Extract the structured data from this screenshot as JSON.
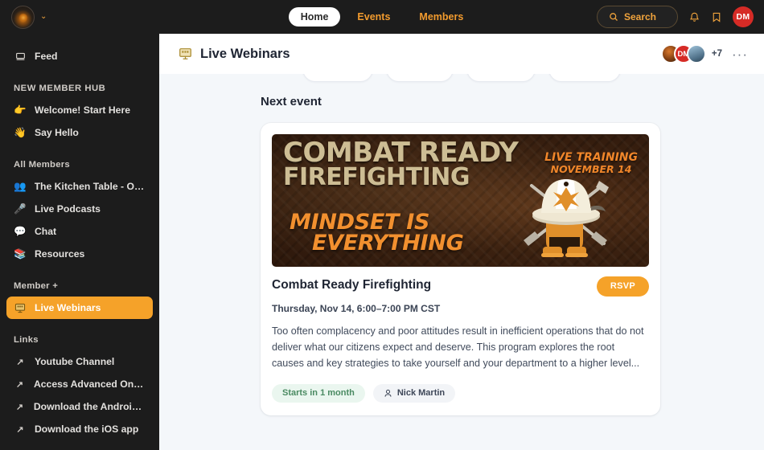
{
  "topbar": {
    "logo_name": "community-logo",
    "chevron": "⌄",
    "nav": [
      {
        "label": "Home",
        "active": true
      },
      {
        "label": "Events",
        "active": false
      },
      {
        "label": "Members",
        "active": false
      }
    ],
    "search_label": "Search",
    "notifications_icon": "bell-icon",
    "bookmarks_icon": "bookmark-icon",
    "user_initials": "DM"
  },
  "sidebar": {
    "feed": {
      "label": "Feed",
      "icon": "feed-icon"
    },
    "sections": [
      {
        "heading": "NEW MEMBER HUB",
        "items": [
          {
            "label": "Welcome! Start Here",
            "icon": "👉"
          },
          {
            "label": "Say Hello",
            "icon": "👋"
          }
        ]
      },
      {
        "heading": "All Members",
        "items": [
          {
            "label": "The Kitchen Table - Open...",
            "icon": "👥"
          },
          {
            "label": "Live Podcasts",
            "icon": "🎤"
          },
          {
            "label": "Chat",
            "icon": "💬"
          },
          {
            "label": "Resources",
            "icon": "📚"
          }
        ]
      },
      {
        "heading": "Member +",
        "items": [
          {
            "label": "Live Webinars",
            "icon": "📺",
            "active": true
          }
        ]
      },
      {
        "heading": "Links",
        "items": [
          {
            "label": "Youtube Channel",
            "icon": "↗"
          },
          {
            "label": "Access Advanced Onlin...",
            "icon": "↗"
          },
          {
            "label": "Download the Android a...",
            "icon": "↗"
          },
          {
            "label": "Download the iOS app",
            "icon": "↗"
          }
        ]
      }
    ]
  },
  "main": {
    "title": "Live Webinars",
    "title_icon": "webinar-screen-icon",
    "member_overflow_count": "+7",
    "more_menu": "···",
    "section_heading": "Next event"
  },
  "event": {
    "banner": {
      "title_line1": "COMBAT READY",
      "title_line2": "FIREFIGHTING",
      "live_line1": "LIVE TRAINING",
      "live_line2": "NOVEMBER 14",
      "tagline_line1": "MINDSET IS",
      "tagline_line2": "EVERYTHING",
      "art": "firefighter-helmet-boots-axes"
    },
    "title": "Combat Ready Firefighting",
    "rsvp_label": "RSVP",
    "date": "Thursday, Nov 14, 6:00–7:00 PM CST",
    "description": "Too often complacency and poor attitudes result in inefficient operations that do not deliver what our citizens expect and deserve. This program explores the root causes and key strategies to take yourself and your department to a higher level...",
    "status_pill": "Starts in 1 month",
    "host_name": "Nick Martin"
  },
  "colors": {
    "accent_orange": "#f5a229",
    "nav_orange": "#f29b2e",
    "dark_bg": "#1c1c1c",
    "content_bg": "#f4f7fa",
    "avatar_red": "#d62b26",
    "status_green": "#4a8a62"
  }
}
